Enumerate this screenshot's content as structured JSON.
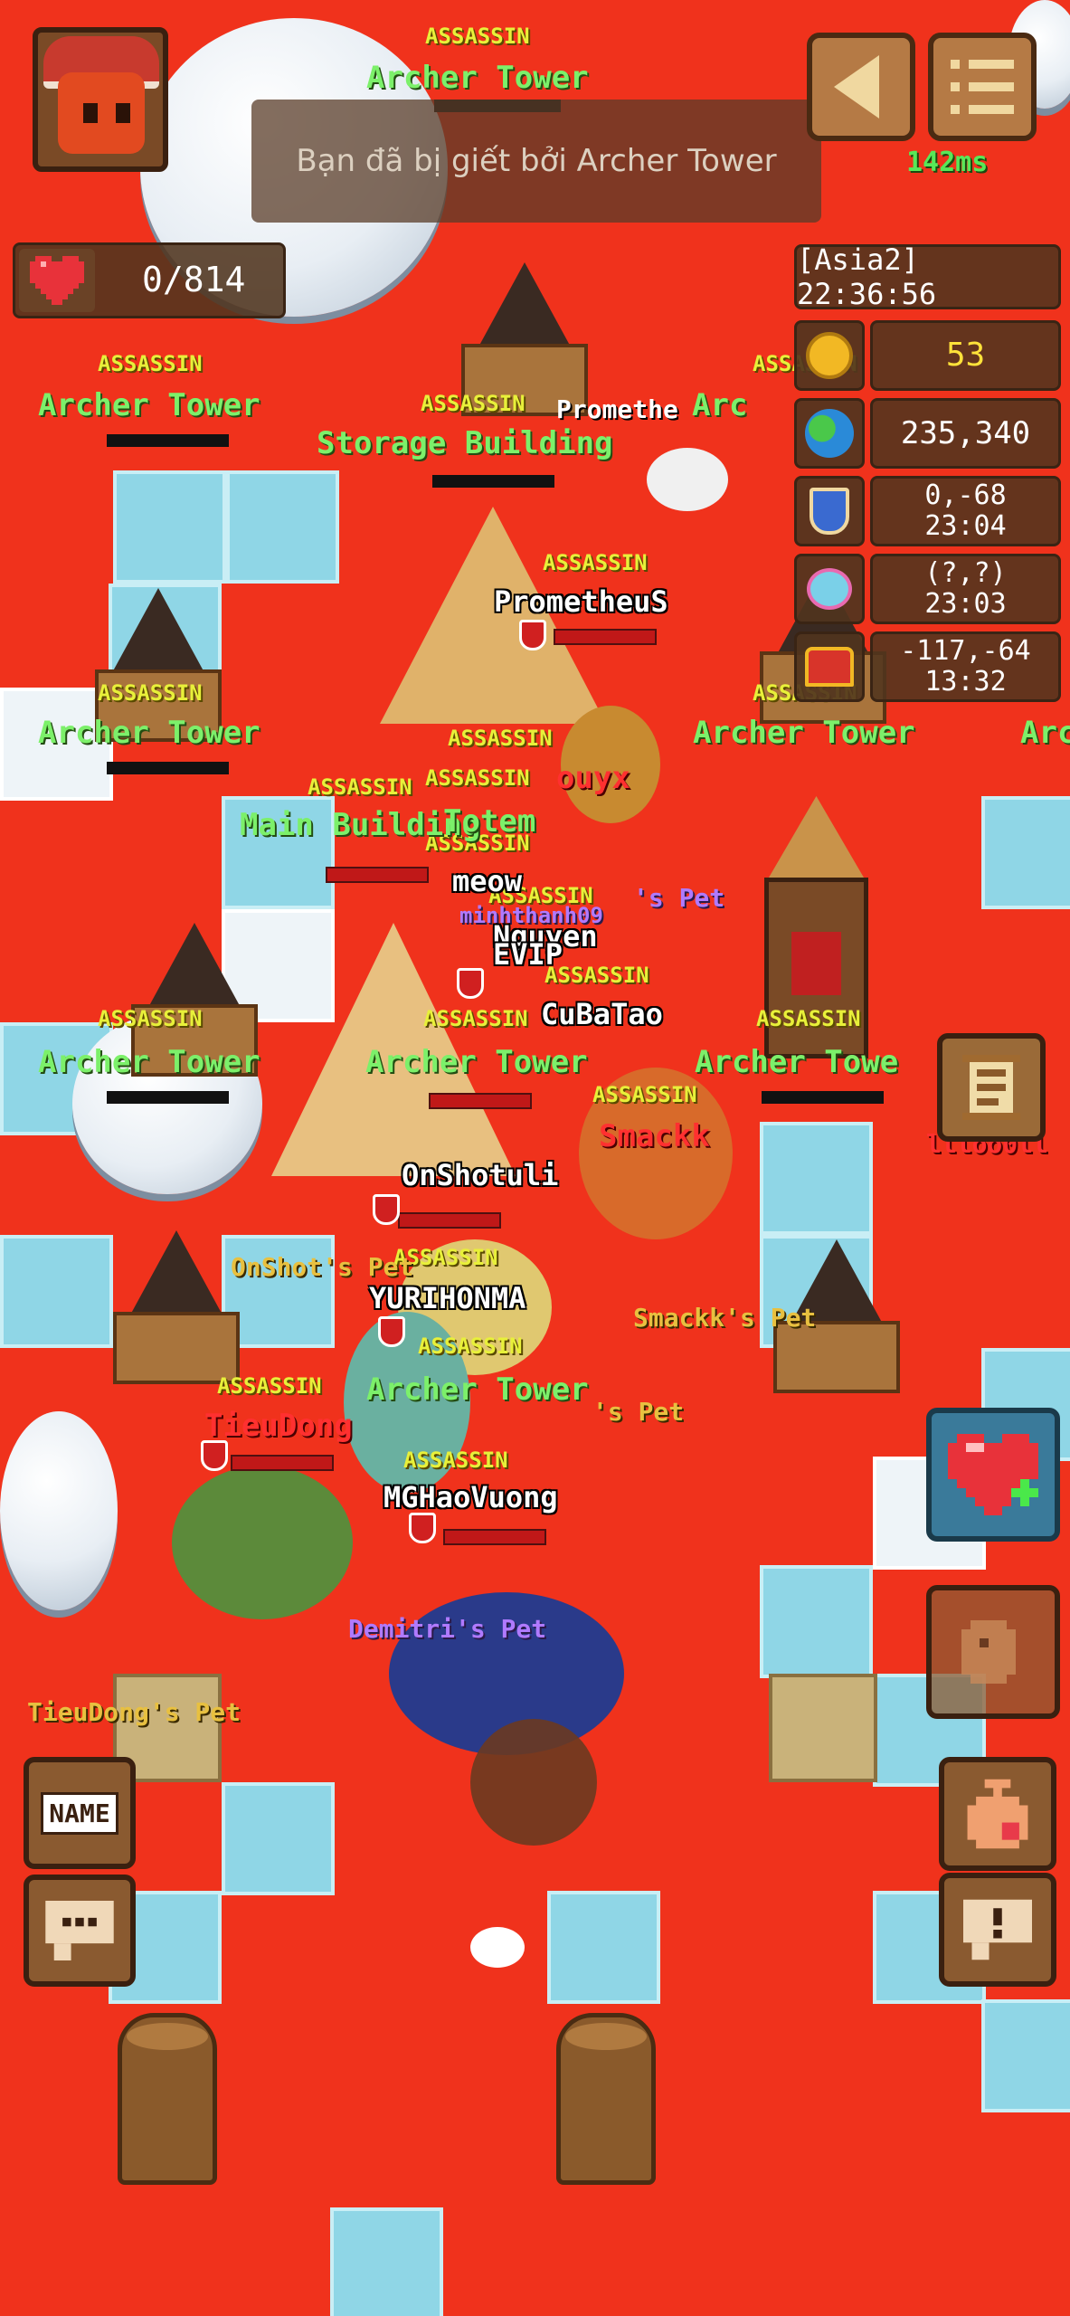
{
  "notification": "Bạn đã bị giết bởi Archer Tower",
  "health": {
    "label": "0/814"
  },
  "ping": "142ms",
  "server": {
    "label": "[Asia2] 22:36:56"
  },
  "resources": {
    "gold": "53",
    "population": "235,340",
    "guild_line1": "0,-68",
    "guild_line2": "23:04",
    "pet_line1": "(?,?)",
    "pet_line2": "23:03",
    "chest_line1": "-117,-64",
    "chest_line2": "13:32"
  },
  "buttons": {
    "name_label": "NAME"
  },
  "world_labels": {
    "assassin": "ASSASSIN",
    "archer_tower": "Archer Tower",
    "archer_tower_clip": "Archer Towe",
    "archer_tower_edge": "Arc",
    "archer_tower_edge2": "Arc",
    "storage_building": "Storage Building",
    "main_building": "Main Building",
    "totem": "Totem",
    "prometheus": "PrometheuS",
    "prometheus_clip": "Promethe",
    "meow": "meow",
    "nguyen": "Nguyen",
    "evip": "EVIP",
    "cubatao": "CuBaTao",
    "onshotul": "OnShotuli",
    "smackk": "Smackk",
    "smackk_pet": "Smackk's Pet",
    "onshot_pet": "OnShot's Pet",
    "yurihonma": "YURIHONMA",
    "tieudong": "TieuDong",
    "tieudong_pet": "TieuDong's Pet",
    "mghaovuong": "MGHaoVuong",
    "demitri_pet": "Demitri's Pet",
    "s_pet": "'s Pet",
    "s_pet2": "'s Pet",
    "iiioo": "llloo0ll",
    "minhthanh": "minhthanh09",
    "ouyx": "ouyx"
  },
  "colors": {
    "ground": "#f0321c",
    "ice": "#8fd6e6",
    "building_label": "#7cf06a",
    "class_label": "#e8f03a",
    "hud_panel": "#50341e"
  },
  "icons": {
    "avatar": "player-avatar",
    "back": "back-arrow-icon",
    "menu": "menu-list-icon",
    "health": "heart-icon",
    "gold": "gold-coin-icon",
    "world": "globe-icon",
    "guild": "guild-shield-icon",
    "pet": "pet-icon",
    "chest": "treasure-chest-icon",
    "quest": "scroll-icon",
    "heal": "heart-potion-icon",
    "emote": "chicken-icon",
    "inventory": "bag-icon",
    "chat": "chat-bubble-icon",
    "alert": "alert-icon"
  }
}
